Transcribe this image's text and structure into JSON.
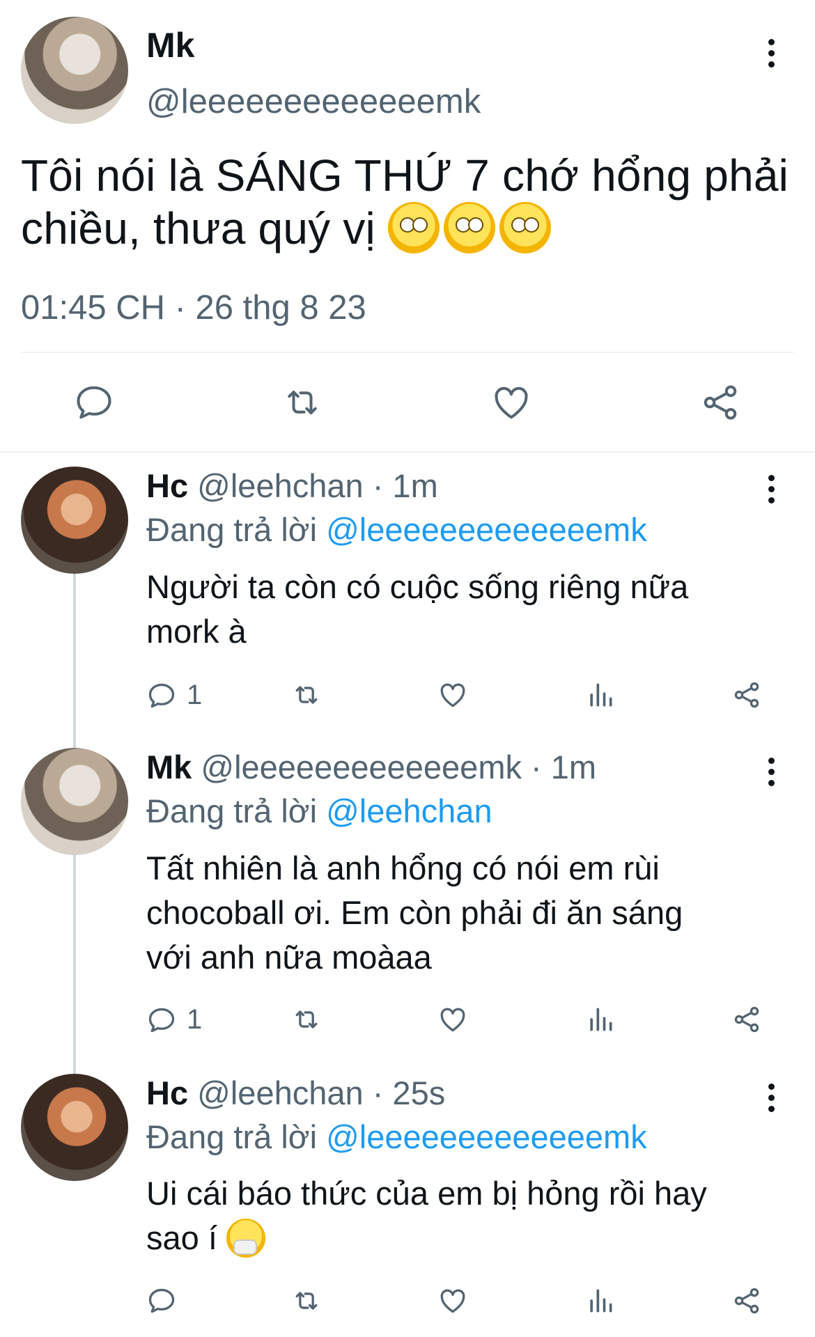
{
  "main_tweet": {
    "name": "Mk",
    "handle": "@leeeeeeeeeeeeemk",
    "text_line1": "Tôi nói là SÁNG THỨ 7 chớ hổng phải",
    "text_line2": "chiều, thưa quý vị",
    "emoji": "face-with-rolling-eyes",
    "timestamp": "01:45 CH · 26 thg 8 23"
  },
  "replies": [
    {
      "name": "Hc",
      "handle": "@leehchan",
      "time": "· 1m",
      "replying_label": "Đang trả lời",
      "replying_to": "@leeeeeeeeeeeeemk",
      "text_line1": "Người ta còn có cuộc sống riêng nữa",
      "text_line2": "mork à",
      "reply_count": "1"
    },
    {
      "name": "Mk",
      "handle": "@leeeeeeeeeeeeemk",
      "time": "· 1m",
      "replying_label": "Đang trả lời",
      "replying_to": "@leehchan",
      "text_line1": "Tất nhiên là anh hổng có nói em rùi",
      "text_line2": "chocoball ơi. Em còn phải đi ăn sáng",
      "text_line3": "với anh nữa moàaa",
      "reply_count": "1"
    },
    {
      "name": "Hc",
      "handle": "@leehchan",
      "time": "· 25s",
      "replying_label": "Đang trả lời",
      "replying_to": "@leeeeeeeeeeeeemk",
      "text_line1": "Ui cái báo thức của em bị hỏng rồi hay",
      "text_line2": "sao í",
      "emoji": "sneezing-face"
    }
  ],
  "colors": {
    "text": "#0f1419",
    "muted": "#536471",
    "link": "#1d9bf0",
    "divider": "#eff3f4"
  }
}
